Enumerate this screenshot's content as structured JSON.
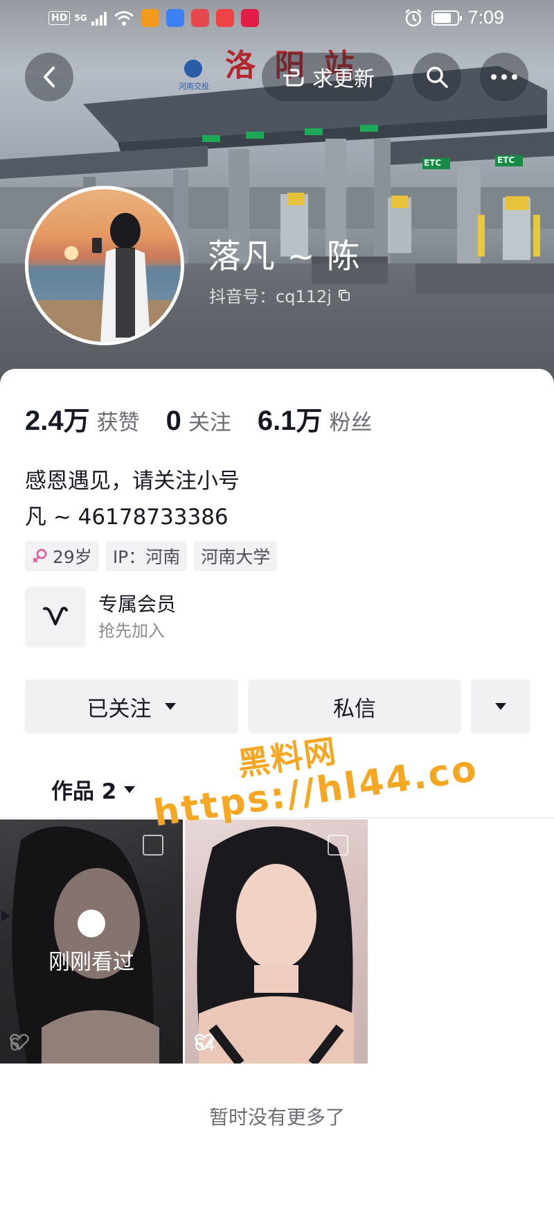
{
  "status_bar": {
    "hd_tag": "HD",
    "network": "5G",
    "time": "7:09",
    "app_icons": [
      "player-app-icon",
      "store-app-icon",
      "red-app-icon",
      "shop-app-icon",
      "heart-app-icon"
    ],
    "colors": {
      "player": "#f39a1e",
      "store": "#3b82f6",
      "red": "#e5484d",
      "shop": "#ef4444",
      "heart": "#e11d48"
    }
  },
  "header": {
    "update_label": "求更新",
    "cover_text": "洛 阳 站",
    "cover_signs": [
      "ETC",
      "ETC"
    ],
    "cover_logo_text": "河南交投"
  },
  "profile": {
    "nickname": "落凡 ~ 陈",
    "douyin_id": "抖音号：cq112j"
  },
  "stats": [
    {
      "num": "2.4",
      "unit": "万",
      "label": "获赞"
    },
    {
      "num": "0",
      "unit": "",
      "label": "关注"
    },
    {
      "num": "6.1",
      "unit": "万",
      "label": "粉丝"
    }
  ],
  "bio": {
    "line1": "感恩遇见，请关注小号",
    "line2": "凡 ~ 46178733386"
  },
  "tags": [
    {
      "text": "29岁",
      "icon": "female-icon",
      "color": "#e0569c"
    },
    {
      "text": "IP：河南"
    },
    {
      "text": "河南大学"
    }
  ],
  "member": {
    "title": "专属会员",
    "subtitle": "抢先加入"
  },
  "actions": {
    "follow_label": "已关注",
    "message_label": "私信"
  },
  "tabs": {
    "works_label": "作品 2"
  },
  "videos": [
    {
      "likes": "6",
      "overlay_label": "刚刚看过"
    },
    {
      "likes": "64"
    }
  ],
  "end_text": "暂时没有更多了",
  "watermark": {
    "line1": "黑料网",
    "line2": "https://hl44.co",
    "color": "#f5a623"
  }
}
